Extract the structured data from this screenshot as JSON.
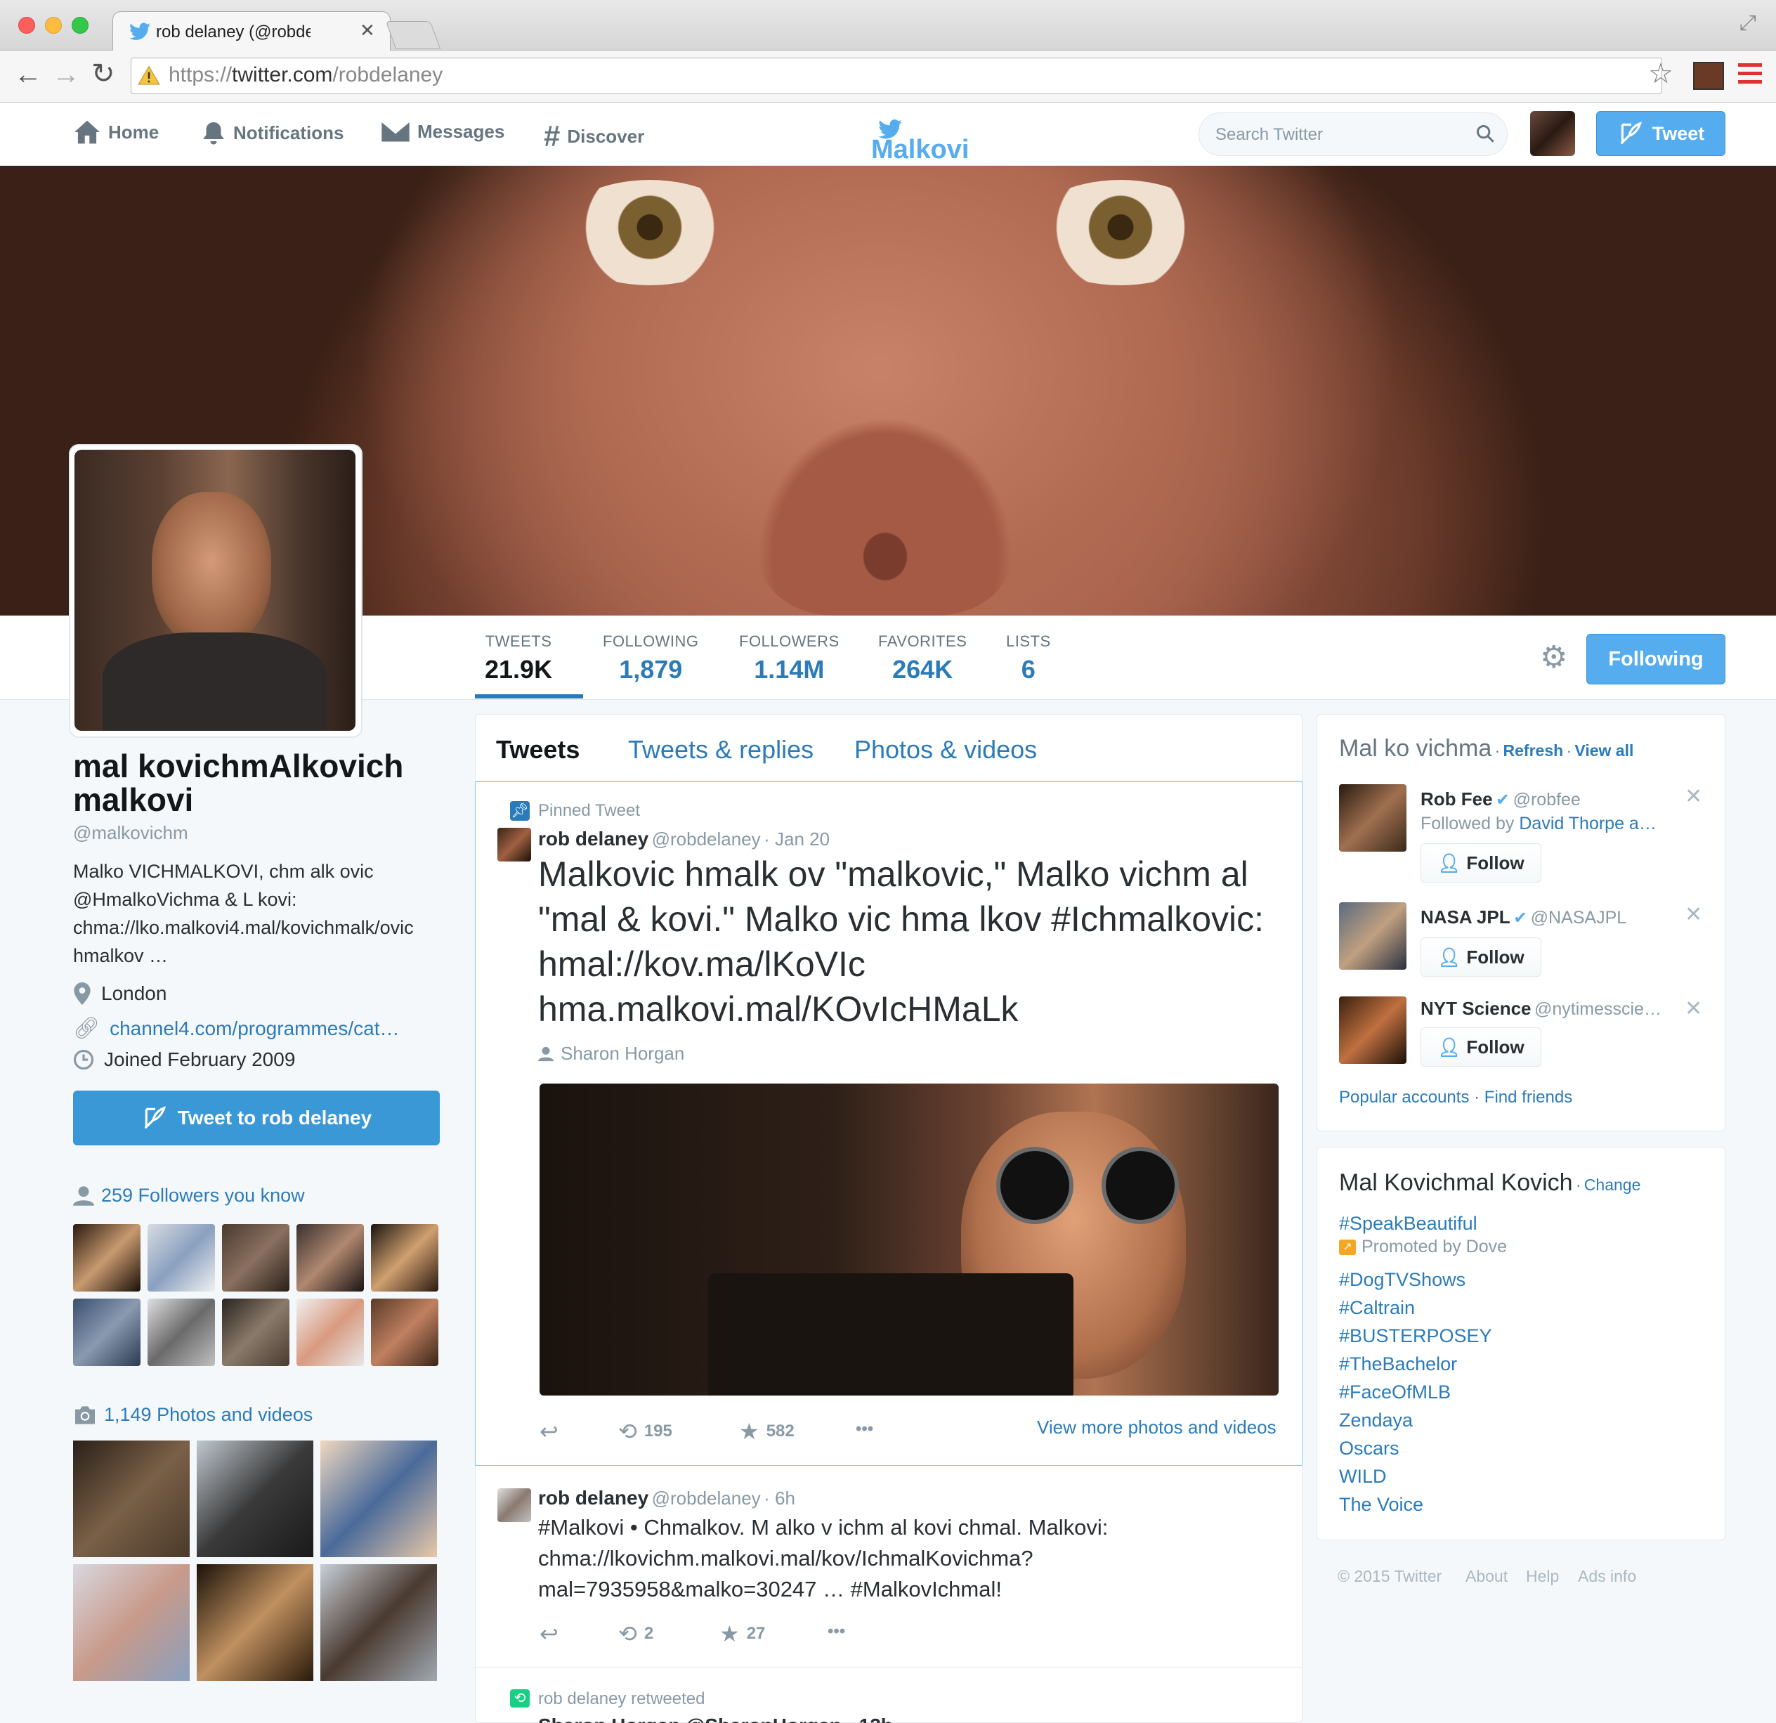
{
  "browser": {
    "tab_title": "rob delaney (@robde",
    "url_scheme": "https://",
    "url_host": "twitter.com",
    "url_path": "/robdelaney"
  },
  "nav": {
    "home": "Home",
    "notifications": "Notifications",
    "messages": "Messages",
    "discover": "Discover",
    "logo_text": "Malkovi",
    "search_placeholder": "Search Twitter",
    "tweet_button": "Tweet"
  },
  "stats": [
    {
      "label": "TWEETS",
      "value": "21.9K"
    },
    {
      "label": "FOLLOWING",
      "value": "1,879"
    },
    {
      "label": "FOLLOWERS",
      "value": "1.14M"
    },
    {
      "label": "FAVORITES",
      "value": "264K"
    },
    {
      "label": "LISTS",
      "value": "6"
    }
  ],
  "following_button": "Following",
  "profile": {
    "name": "mal kovichmAlkovich malkovi",
    "handle": "@malkovichm",
    "bio": "Malko VICHMALKOVI, chm alk ovic @HmalkoVichma & L kovi: chma://lko.malkovi4.mal/kovichmalk/ovic hmalkov …",
    "location": "London",
    "website": "channel4.com/programmes/cat…",
    "joined": "Joined February 2009",
    "tweet_to": "Tweet to rob delaney",
    "followers_you_know": "259 Followers you know",
    "photos_videos": "1,149 Photos and videos"
  },
  "timeline": {
    "tabs": [
      "Tweets",
      "Tweets & replies",
      "Photos & videos"
    ],
    "pinned_label": "Pinned Tweet",
    "pinned": {
      "name": "rob delaney",
      "handle": "@robdelaney",
      "time": "· Jan 20",
      "text": "Malkovic hmalk ov \"malkovic,\" Malko vichm al \"mal & kovi.\" Malko vic hma lkov #Ichmalkovic: hmal://kov.ma/lKoVIc hma.malkovi.mal/KOvIcHMaLk",
      "tagged": "Sharon Horgan",
      "retweets": "195",
      "favorites": "582",
      "more": "•••",
      "view_more": "View more photos and videos"
    },
    "tweet2": {
      "name": "rob delaney",
      "handle": "@robdelaney",
      "time": "· 6h",
      "text": "#Malkovi • Chmalkov. M alko v ichm al kovi chmal. Malkovi: chma://lkovichm.malkovi.mal/kov/IchmalKovichma?mal=7935958&malko=30247 … #MalkovIchmal!",
      "retweets": "2",
      "favorites": "27",
      "more": "•••"
    },
    "retweeted_label": "rob delaney retweeted",
    "tweet3_partial": "Sharon Horgan @SharonHorgan · 12h"
  },
  "who_to_follow": {
    "title": "Mal ko vichma",
    "refresh": "Refresh",
    "sep": "·",
    "view_all": "View all",
    "accounts": [
      {
        "name": "Rob Fee",
        "handle": "@robfee",
        "sub_prefix": "Followed by",
        "sub_link": "David Thorpe a…",
        "follow": "Follow"
      },
      {
        "name": "NASA JPL",
        "handle": "@NASAJPL",
        "follow": "Follow"
      },
      {
        "name": "NYT Science",
        "handle": "@nytimesscie…",
        "follow": "Follow"
      }
    ],
    "popular": "Popular accounts",
    "find_friends": "Find friends"
  },
  "trends": {
    "title": "Mal Kovichmal Kovich",
    "change": "Change",
    "promoted_tag": "#SpeakBeautiful",
    "promoted_by": "Promoted by Dove",
    "items": [
      "#DogTVShows",
      "#Caltrain",
      "#BUSTERPOSEY",
      "#TheBachelor",
      "#FaceOfMLB",
      "Zendaya",
      "Oscars",
      "WILD",
      "The Voice"
    ]
  },
  "footer": [
    "© 2015 Twitter",
    "About",
    "Help",
    "Ads info"
  ],
  "colors": {
    "brand": "#55acee",
    "link": "#2b7bb9"
  }
}
